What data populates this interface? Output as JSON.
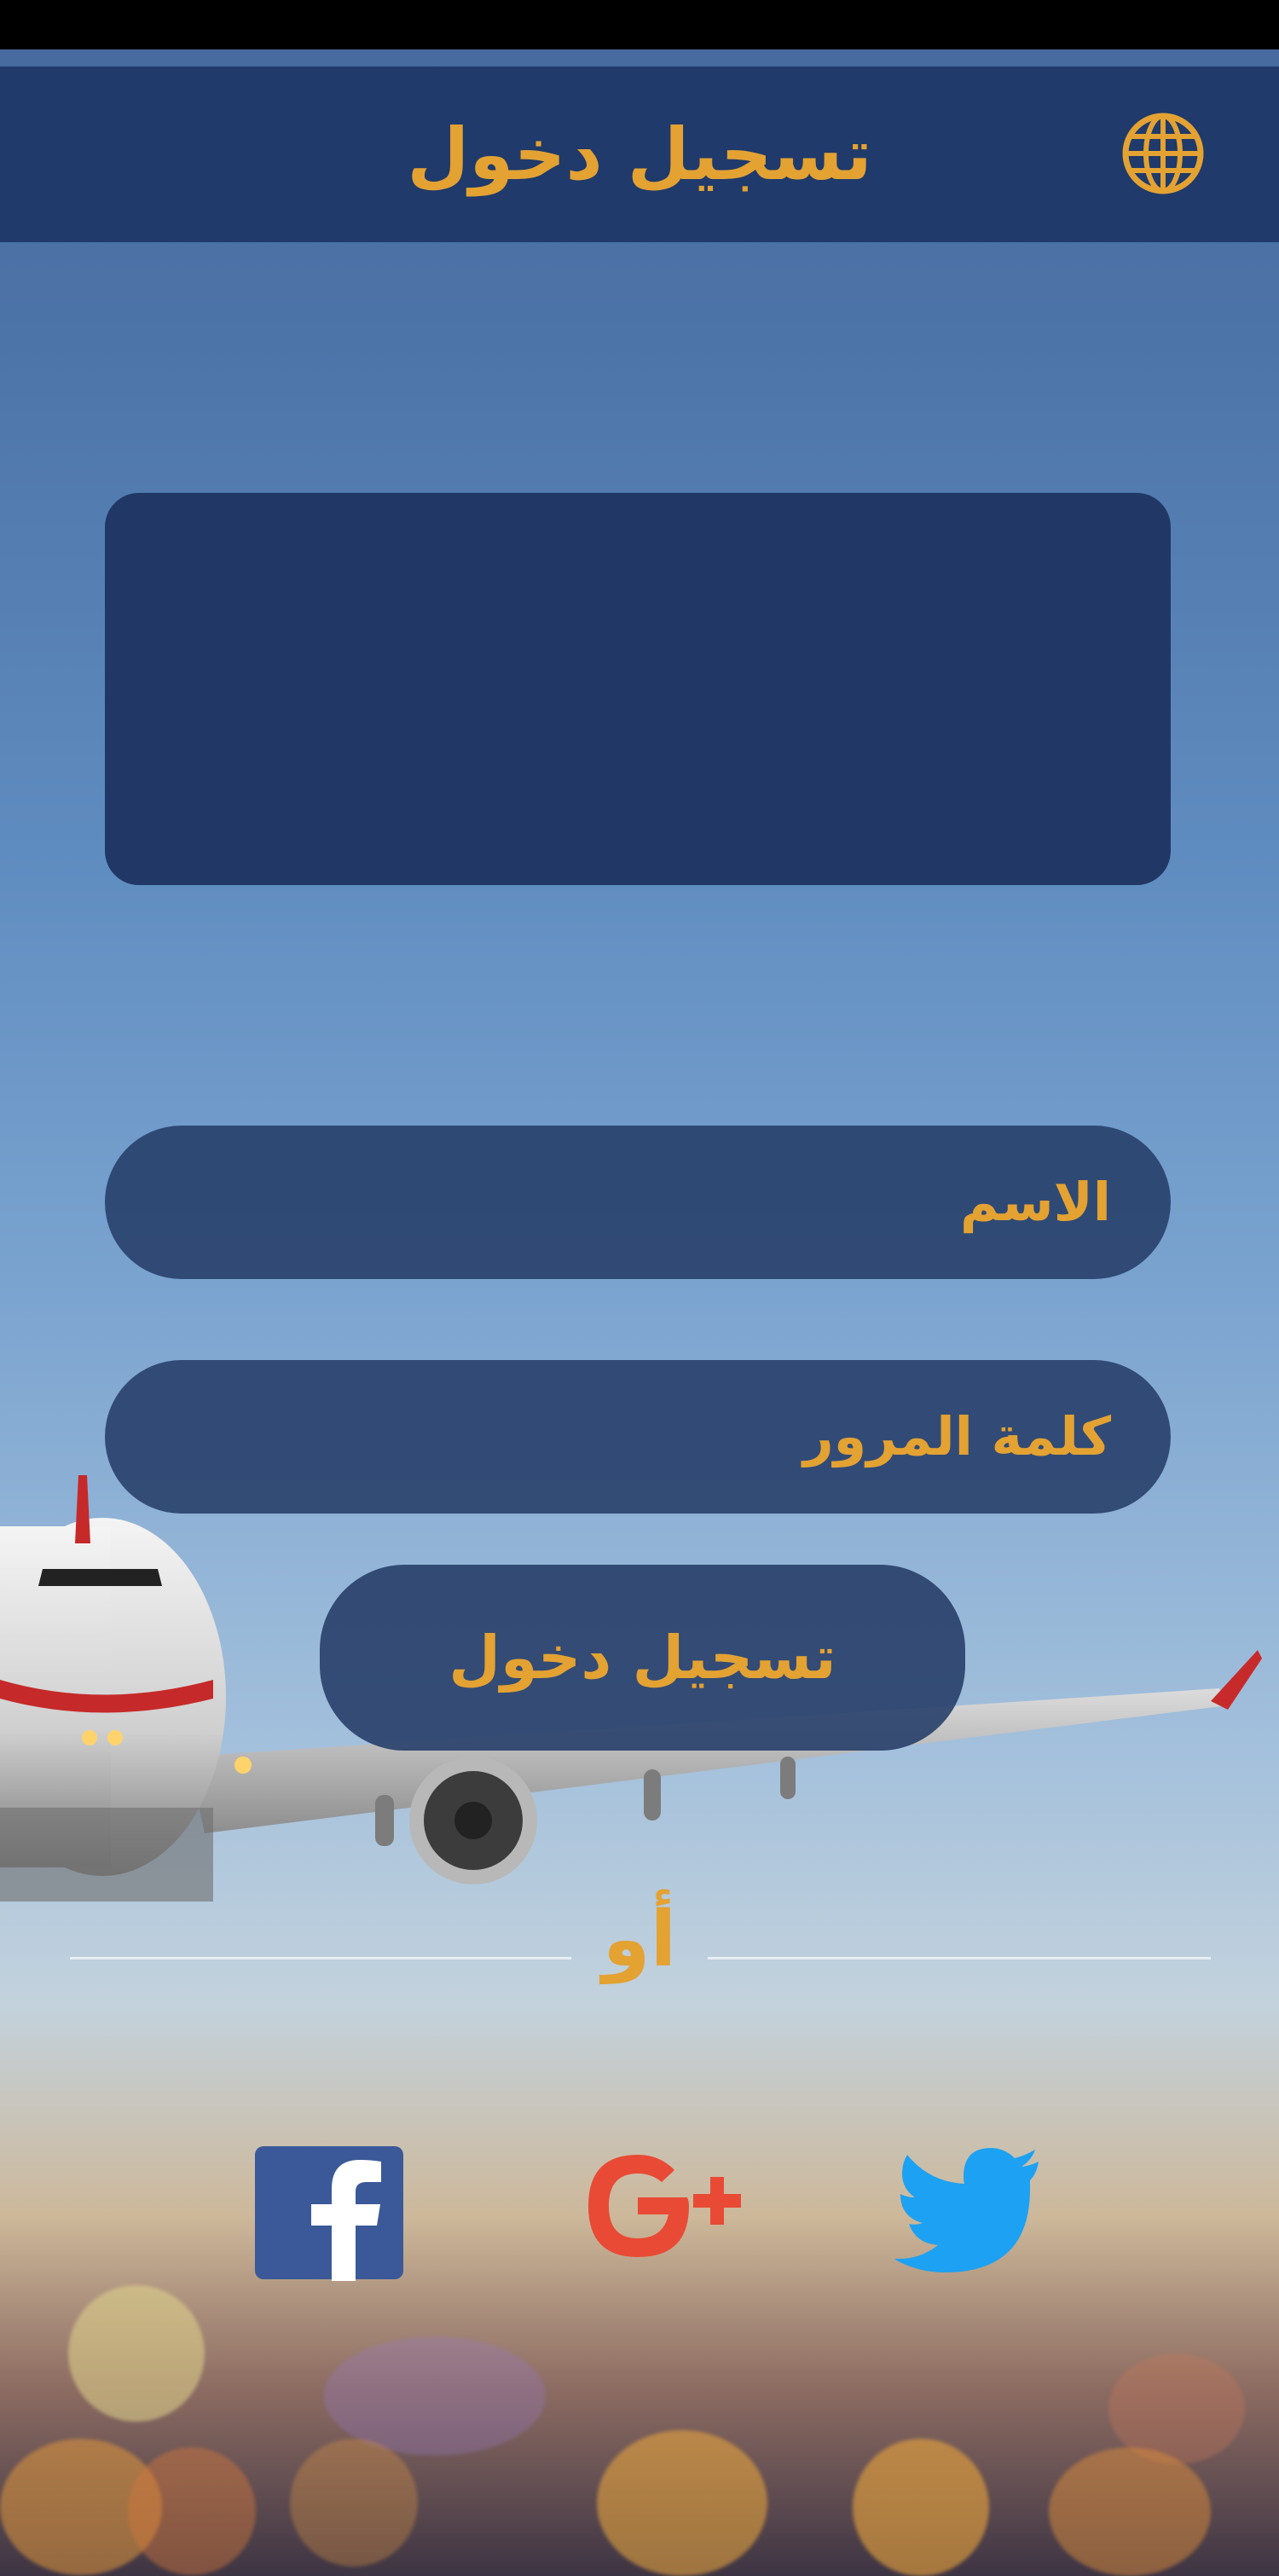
{
  "header": {
    "title": "تسجيل دخول",
    "language_icon": "globe-icon"
  },
  "form": {
    "name_placeholder": "الاسم",
    "password_placeholder": "كلمة المرور",
    "login_button": "تسجيل دخول"
  },
  "divider": {
    "or_text": "أو"
  },
  "social": [
    {
      "icon": "facebook-icon",
      "color": "#3b5998"
    },
    {
      "icon": "google-plus-icon",
      "color": "#e94a35"
    },
    {
      "icon": "twitter-icon",
      "color": "#1da1f2"
    }
  ],
  "colors": {
    "accent": "#e3a232",
    "header_bg": "#1f3a6b",
    "field_bg": "#263e69"
  }
}
